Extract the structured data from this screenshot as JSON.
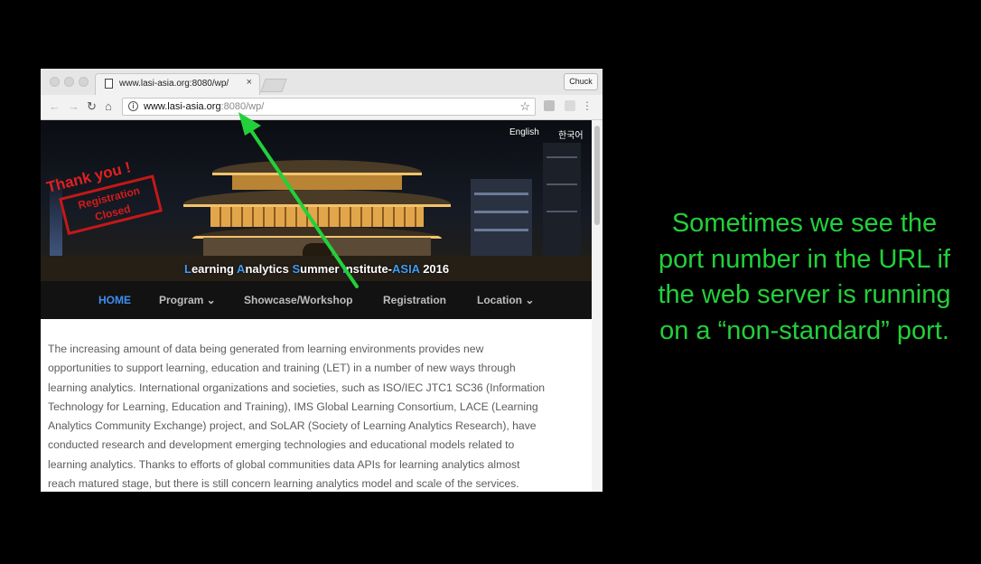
{
  "browser": {
    "tab_title": "www.lasi-asia.org:8080/wp/",
    "tab_close": "×",
    "profile_label": "Chuck",
    "url_host": "www.lasi-asia.org",
    "url_port_path": ":8080/wp/",
    "icons": {
      "back": "back-arrow-icon",
      "forward": "forward-arrow-icon",
      "reload": "reload-icon",
      "home": "home-icon",
      "info": "info-icon",
      "star": "bookmark-star-icon",
      "menu": "menu-dots-icon"
    }
  },
  "site": {
    "lang_english": "English",
    "lang_korean": "한국어",
    "stamp_title": "Thank you !",
    "stamp_line1": "Registration",
    "stamp_line2": "Closed",
    "banner": {
      "l": "L",
      "earning": "earning ",
      "a": "A",
      "nalytics": "nalytics ",
      "s": "S",
      "ummer": "ummer ",
      "i": "I",
      "nstitute": "nstitute-",
      "asia": "ASIA",
      "year": " 2016"
    },
    "nav": {
      "home": "HOME",
      "program": "Program ⌄",
      "showcase": "Showcase/Workshop",
      "registration": "Registration",
      "location": "Location ⌄"
    },
    "body_lines": [
      "The increasing amount of data being generated from learning environments provides new",
      "opportunities to support learning, education and training (LET) in a number of new ways through",
      "learning analytics. International organizations and societies, such as ISO/IEC JTC1 SC36 (Information",
      "Technology for Learning, Education and Training), IMS Global Learning Consortium, LACE (Learning",
      "Analytics Community Exchange) project, and SoLAR (Society of Learning Analytics Research), have",
      "conducted research and development emerging technologies and educational models related to",
      "learning analytics. Thanks to efforts of global communities data APIs for learning analytics almost",
      "reach matured stage, but there is still concern learning analytics model and scale of the services."
    ]
  },
  "caption": {
    "lines": [
      "Sometimes we see the",
      "port number in the URL if",
      "the web server is running",
      "on a “non-standard” port."
    ],
    "color": "#22d03a"
  },
  "arrow_color": "#22d03a"
}
